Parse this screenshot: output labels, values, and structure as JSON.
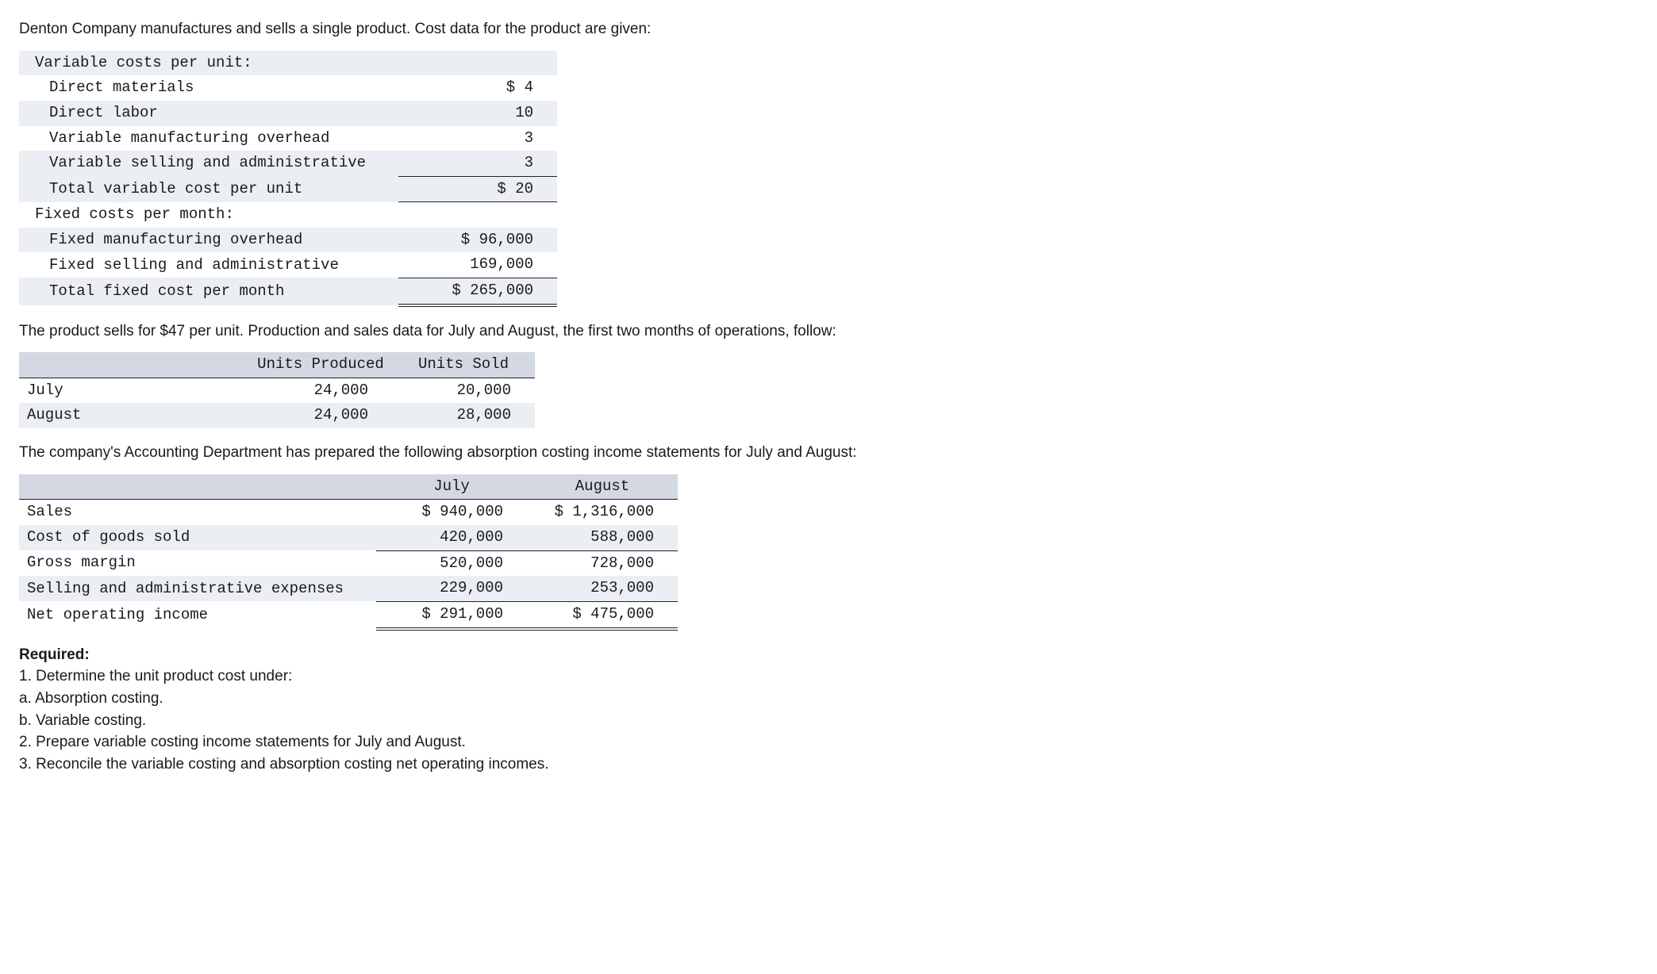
{
  "intro": "Denton Company manufactures and sells a single product. Cost data for the product are given:",
  "cost_table": {
    "var_header": "Variable costs per unit:",
    "rows_var": [
      {
        "label": "Direct materials",
        "value": "$ 4"
      },
      {
        "label": "Direct labor",
        "value": "10"
      },
      {
        "label": "Variable manufacturing overhead",
        "value": "3"
      },
      {
        "label": "Variable selling and administrative",
        "value": "3"
      }
    ],
    "var_total_label": "Total variable cost per unit",
    "var_total_value": "$ 20",
    "fix_header": "Fixed costs per month:",
    "rows_fix": [
      {
        "label": "Fixed manufacturing overhead",
        "value": "$ 96,000"
      },
      {
        "label": "Fixed selling and administrative",
        "value": "169,000"
      }
    ],
    "fix_total_label": "Total fixed cost per month",
    "fix_total_value": "$ 265,000"
  },
  "para2": "The product sells for $47 per unit. Production and sales data for July and August, the first two months of operations, follow:",
  "units_table": {
    "headers": [
      "",
      "Units Produced",
      "Units Sold"
    ],
    "rows": [
      {
        "label": "July",
        "produced": "24,000",
        "sold": "20,000"
      },
      {
        "label": "August",
        "produced": "24,000",
        "sold": "28,000"
      }
    ]
  },
  "para3": "The company's Accounting Department has prepared the following absorption costing income statements for July and August:",
  "income_table": {
    "headers": [
      "",
      "July",
      "August"
    ],
    "rows": [
      {
        "label": "Sales",
        "july": "$ 940,000",
        "aug": "$ 1,316,000",
        "rule": false
      },
      {
        "label": "Cost of goods sold",
        "july": "420,000",
        "aug": "588,000",
        "rule": true
      },
      {
        "label": "Gross margin",
        "july": "520,000",
        "aug": "728,000",
        "rule": false
      },
      {
        "label": "Selling and administrative expenses",
        "july": "229,000",
        "aug": "253,000",
        "rule": true
      }
    ],
    "noi_label": "Net operating income",
    "noi_july": "$ 291,000",
    "noi_aug": "$ 475,000"
  },
  "required": {
    "title": "Required:",
    "lines": [
      "1. Determine the unit product cost under:",
      "a. Absorption costing.",
      "b. Variable costing.",
      "2. Prepare variable costing income statements for July and August.",
      "3. Reconcile the variable costing and absorption costing net operating incomes."
    ]
  }
}
